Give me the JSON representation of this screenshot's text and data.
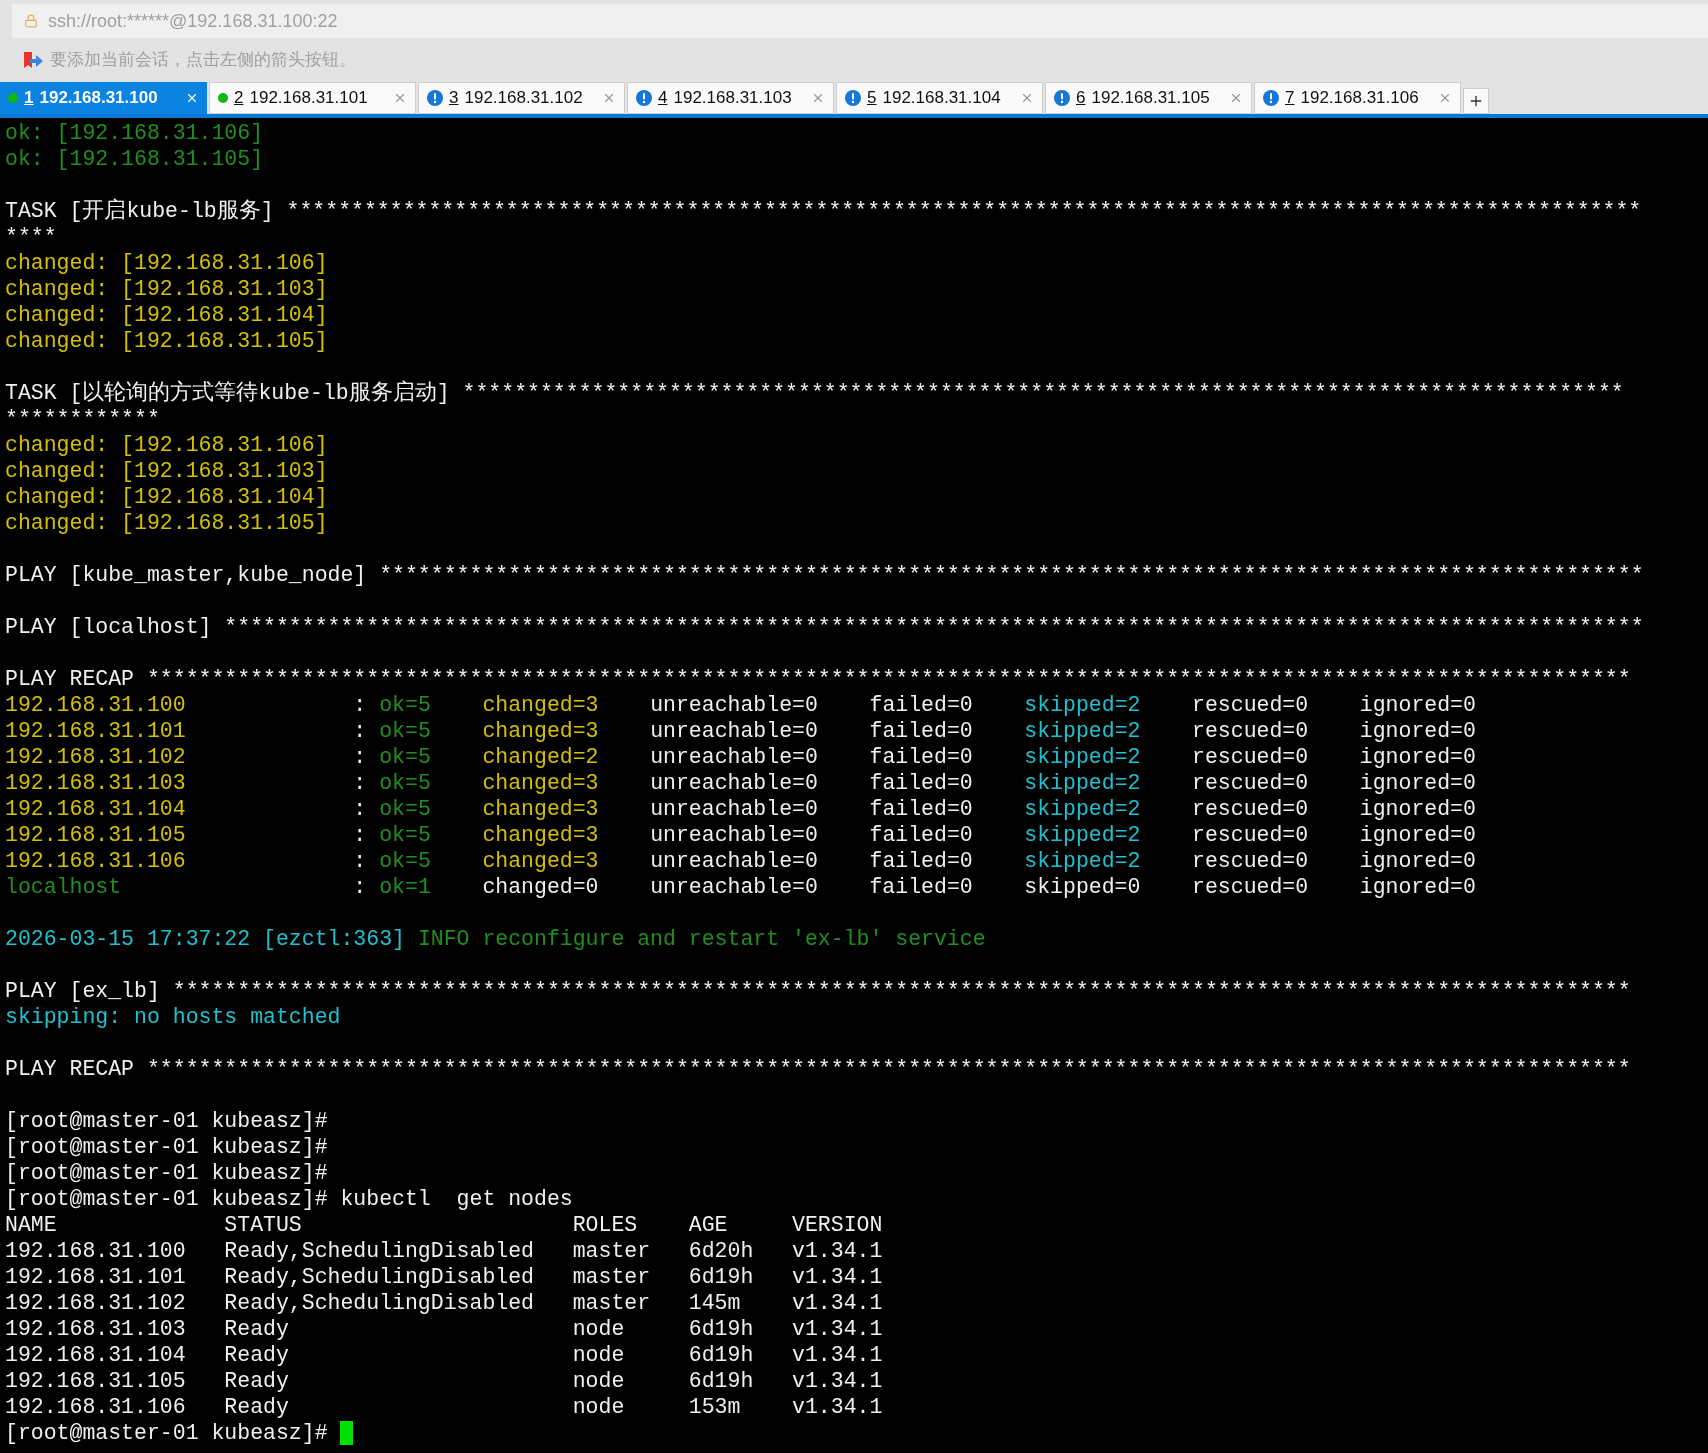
{
  "address_bar": {
    "url": "ssh://root:******@192.168.31.100:22"
  },
  "hint_bar": {
    "text": "要添加当前会话，点击左侧的箭头按钮。"
  },
  "tabs": [
    {
      "number": "1",
      "label": "192.168.31.100",
      "connected": true,
      "selected": true
    },
    {
      "number": "2",
      "label": "192.168.31.101",
      "connected": true,
      "selected": false
    },
    {
      "number": "3",
      "label": "192.168.31.102",
      "connected": false,
      "selected": false
    },
    {
      "number": "4",
      "label": "192.168.31.103",
      "connected": false,
      "selected": false
    },
    {
      "number": "5",
      "label": "192.168.31.104",
      "connected": false,
      "selected": false
    },
    {
      "number": "6",
      "label": "192.168.31.105",
      "connected": false,
      "selected": false
    },
    {
      "number": "7",
      "label": "192.168.31.106",
      "connected": false,
      "selected": false
    }
  ],
  "terminal": {
    "lines": [
      {
        "kind": "text",
        "segments": [
          {
            "text": "ok: [192.168.31.106]",
            "color": "#1f8f1f"
          }
        ]
      },
      {
        "kind": "text",
        "segments": [
          {
            "text": "ok: [192.168.31.105]",
            "color": "#1f8f1f"
          }
        ]
      },
      {
        "kind": "blank"
      },
      {
        "kind": "text",
        "segments": [
          {
            "text": "TASK [开启kube-lb服务] *********************************************************************************************************",
            "color": "#f0f0f0"
          }
        ]
      },
      {
        "kind": "text",
        "segments": [
          {
            "text": "****",
            "color": "#f0f0f0"
          }
        ]
      },
      {
        "kind": "text",
        "segments": [
          {
            "text": "changed: [192.168.31.106]",
            "color": "#d4c000"
          }
        ]
      },
      {
        "kind": "text",
        "segments": [
          {
            "text": "changed: [192.168.31.103]",
            "color": "#d4c000"
          }
        ]
      },
      {
        "kind": "text",
        "segments": [
          {
            "text": "changed: [192.168.31.104]",
            "color": "#d4c000"
          }
        ]
      },
      {
        "kind": "text",
        "segments": [
          {
            "text": "changed: [192.168.31.105]",
            "color": "#d4c000"
          }
        ]
      },
      {
        "kind": "blank"
      },
      {
        "kind": "text",
        "segments": [
          {
            "text": "TASK [以轮询的方式等待kube-lb服务启动] ******************************************************************************************",
            "color": "#f0f0f0"
          }
        ]
      },
      {
        "kind": "text",
        "segments": [
          {
            "text": "************",
            "color": "#f0f0f0"
          }
        ]
      },
      {
        "kind": "text",
        "segments": [
          {
            "text": "changed: [192.168.31.106]",
            "color": "#d4c000"
          }
        ]
      },
      {
        "kind": "text",
        "segments": [
          {
            "text": "changed: [192.168.31.103]",
            "color": "#d4c000"
          }
        ]
      },
      {
        "kind": "text",
        "segments": [
          {
            "text": "changed: [192.168.31.104]",
            "color": "#d4c000"
          }
        ]
      },
      {
        "kind": "text",
        "segments": [
          {
            "text": "changed: [192.168.31.105]",
            "color": "#d4c000"
          }
        ]
      },
      {
        "kind": "blank"
      },
      {
        "kind": "text",
        "segments": [
          {
            "text": "PLAY [kube_master,kube_node] **************************************************************************************************",
            "color": "#f0f0f0"
          }
        ]
      },
      {
        "kind": "blank"
      },
      {
        "kind": "text",
        "segments": [
          {
            "text": "PLAY [localhost] **************************************************************************************************************",
            "color": "#f0f0f0"
          }
        ]
      },
      {
        "kind": "blank"
      },
      {
        "kind": "text",
        "segments": [
          {
            "text": "PLAY RECAP *******************************************************************************************************************",
            "color": "#f0f0f0"
          }
        ]
      },
      {
        "kind": "text",
        "segments": [
          {
            "text": "192.168.31.100            ",
            "color": "#d4c000"
          },
          {
            "text": " : ",
            "color": "#f0f0f0"
          },
          {
            "text": "ok=5    ",
            "color": "#1f8f1f"
          },
          {
            "text": "changed=3    ",
            "color": "#d4c000"
          },
          {
            "text": "unreachable=0    failed=0    ",
            "color": "#f0f0f0"
          },
          {
            "text": "skipped=2    ",
            "color": "#1fc1d1"
          },
          {
            "text": "rescued=0    ignored=0",
            "color": "#f0f0f0"
          }
        ]
      },
      {
        "kind": "text",
        "segments": [
          {
            "text": "192.168.31.101            ",
            "color": "#d4c000"
          },
          {
            "text": " : ",
            "color": "#f0f0f0"
          },
          {
            "text": "ok=5    ",
            "color": "#1f8f1f"
          },
          {
            "text": "changed=3    ",
            "color": "#d4c000"
          },
          {
            "text": "unreachable=0    failed=0    ",
            "color": "#f0f0f0"
          },
          {
            "text": "skipped=2    ",
            "color": "#1fc1d1"
          },
          {
            "text": "rescued=0    ignored=0",
            "color": "#f0f0f0"
          }
        ]
      },
      {
        "kind": "text",
        "segments": [
          {
            "text": "192.168.31.102            ",
            "color": "#d4c000"
          },
          {
            "text": " : ",
            "color": "#f0f0f0"
          },
          {
            "text": "ok=5    ",
            "color": "#1f8f1f"
          },
          {
            "text": "changed=2    ",
            "color": "#d4c000"
          },
          {
            "text": "unreachable=0    failed=0    ",
            "color": "#f0f0f0"
          },
          {
            "text": "skipped=2    ",
            "color": "#1fc1d1"
          },
          {
            "text": "rescued=0    ignored=0",
            "color": "#f0f0f0"
          }
        ]
      },
      {
        "kind": "text",
        "segments": [
          {
            "text": "192.168.31.103            ",
            "color": "#d4c000"
          },
          {
            "text": " : ",
            "color": "#f0f0f0"
          },
          {
            "text": "ok=5    ",
            "color": "#1f8f1f"
          },
          {
            "text": "changed=3    ",
            "color": "#d4c000"
          },
          {
            "text": "unreachable=0    failed=0    ",
            "color": "#f0f0f0"
          },
          {
            "text": "skipped=2    ",
            "color": "#1fc1d1"
          },
          {
            "text": "rescued=0    ignored=0",
            "color": "#f0f0f0"
          }
        ]
      },
      {
        "kind": "text",
        "segments": [
          {
            "text": "192.168.31.104            ",
            "color": "#d4c000"
          },
          {
            "text": " : ",
            "color": "#f0f0f0"
          },
          {
            "text": "ok=5    ",
            "color": "#1f8f1f"
          },
          {
            "text": "changed=3    ",
            "color": "#d4c000"
          },
          {
            "text": "unreachable=0    failed=0    ",
            "color": "#f0f0f0"
          },
          {
            "text": "skipped=2    ",
            "color": "#1fc1d1"
          },
          {
            "text": "rescued=0    ignored=0",
            "color": "#f0f0f0"
          }
        ]
      },
      {
        "kind": "text",
        "segments": [
          {
            "text": "192.168.31.105            ",
            "color": "#d4c000"
          },
          {
            "text": " : ",
            "color": "#f0f0f0"
          },
          {
            "text": "ok=5    ",
            "color": "#1f8f1f"
          },
          {
            "text": "changed=3    ",
            "color": "#d4c000"
          },
          {
            "text": "unreachable=0    failed=0    ",
            "color": "#f0f0f0"
          },
          {
            "text": "skipped=2    ",
            "color": "#1fc1d1"
          },
          {
            "text": "rescued=0    ignored=0",
            "color": "#f0f0f0"
          }
        ]
      },
      {
        "kind": "text",
        "segments": [
          {
            "text": "192.168.31.106            ",
            "color": "#d4c000"
          },
          {
            "text": " : ",
            "color": "#f0f0f0"
          },
          {
            "text": "ok=5    ",
            "color": "#1f8f1f"
          },
          {
            "text": "changed=3    ",
            "color": "#d4c000"
          },
          {
            "text": "unreachable=0    failed=0    ",
            "color": "#f0f0f0"
          },
          {
            "text": "skipped=2    ",
            "color": "#1fc1d1"
          },
          {
            "text": "rescued=0    ignored=0",
            "color": "#f0f0f0"
          }
        ]
      },
      {
        "kind": "text",
        "segments": [
          {
            "text": "localhost                 ",
            "color": "#1f8f1f"
          },
          {
            "text": " : ",
            "color": "#f0f0f0"
          },
          {
            "text": "ok=1    ",
            "color": "#1f8f1f"
          },
          {
            "text": "changed=0    unreachable=0    failed=0    skipped=0    rescued=0    ignored=0",
            "color": "#f0f0f0"
          }
        ]
      },
      {
        "kind": "blank"
      },
      {
        "kind": "text",
        "segments": [
          {
            "text": "2026-03-15 17:37:22 [ezctl:363] ",
            "color": "#1fc1d1"
          },
          {
            "text": "INFO reconfigure and restart 'ex-lb' service",
            "color": "#1f8f1f"
          }
        ]
      },
      {
        "kind": "blank"
      },
      {
        "kind": "text",
        "segments": [
          {
            "text": "PLAY [ex_lb] *****************************************************************************************************************",
            "color": "#f0f0f0"
          }
        ]
      },
      {
        "kind": "text",
        "segments": [
          {
            "text": "skipping: no hosts matched",
            "color": "#1fc1d1"
          }
        ]
      },
      {
        "kind": "blank"
      },
      {
        "kind": "text",
        "segments": [
          {
            "text": "PLAY RECAP *******************************************************************************************************************",
            "color": "#f0f0f0"
          }
        ]
      },
      {
        "kind": "blank"
      },
      {
        "kind": "text",
        "segments": [
          {
            "text": "[root@master-01 kubeasz]#",
            "color": "#f0f0f0"
          }
        ]
      },
      {
        "kind": "text",
        "segments": [
          {
            "text": "[root@master-01 kubeasz]#",
            "color": "#f0f0f0"
          }
        ]
      },
      {
        "kind": "text",
        "segments": [
          {
            "text": "[root@master-01 kubeasz]#",
            "color": "#f0f0f0"
          }
        ]
      },
      {
        "kind": "text",
        "segments": [
          {
            "text": "[root@master-01 kubeasz]# kubectl  get nodes",
            "color": "#f0f0f0"
          }
        ]
      },
      {
        "kind": "text",
        "segments": [
          {
            "text": "NAME             STATUS                     ROLES    AGE     VERSION",
            "color": "#f0f0f0"
          }
        ]
      },
      {
        "kind": "text",
        "segments": [
          {
            "text": "192.168.31.100   Ready,SchedulingDisabled   master   6d20h   v1.34.1",
            "color": "#f0f0f0"
          }
        ]
      },
      {
        "kind": "text",
        "segments": [
          {
            "text": "192.168.31.101   Ready,SchedulingDisabled   master   6d19h   v1.34.1",
            "color": "#f0f0f0"
          }
        ]
      },
      {
        "kind": "text",
        "segments": [
          {
            "text": "192.168.31.102   Ready,SchedulingDisabled   master   145m    v1.34.1",
            "color": "#f0f0f0"
          }
        ]
      },
      {
        "kind": "text",
        "segments": [
          {
            "text": "192.168.31.103   Ready                      node     6d19h   v1.34.1",
            "color": "#f0f0f0"
          }
        ]
      },
      {
        "kind": "text",
        "segments": [
          {
            "text": "192.168.31.104   Ready                      node     6d19h   v1.34.1",
            "color": "#f0f0f0"
          }
        ]
      },
      {
        "kind": "text",
        "segments": [
          {
            "text": "192.168.31.105   Ready                      node     6d19h   v1.34.1",
            "color": "#f0f0f0"
          }
        ]
      },
      {
        "kind": "text",
        "segments": [
          {
            "text": "192.168.31.106   Ready                      node     153m    v1.34.1",
            "color": "#f0f0f0"
          }
        ]
      },
      {
        "kind": "prompt",
        "segments": [
          {
            "text": "[root@master-01 kubeasz]# ",
            "color": "#f0f0f0"
          }
        ]
      }
    ]
  }
}
